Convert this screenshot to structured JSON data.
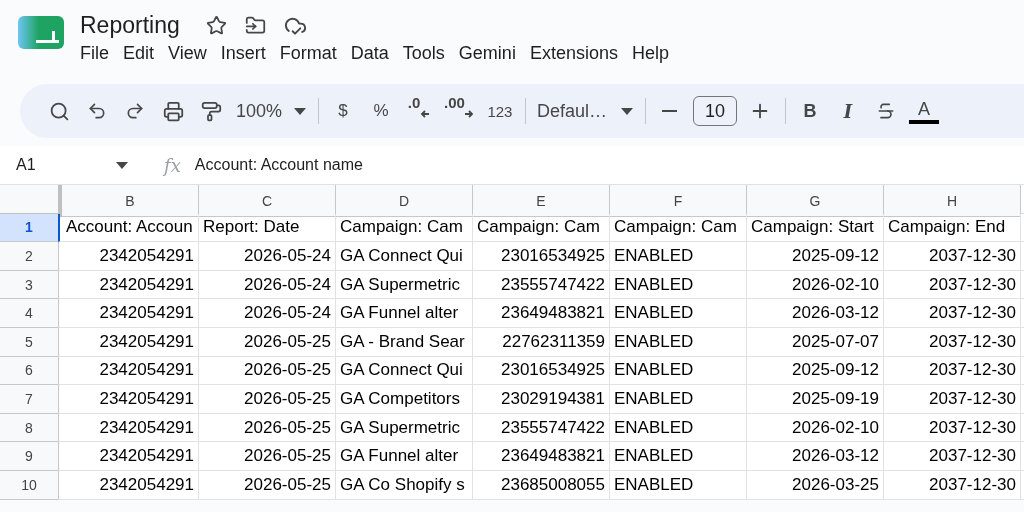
{
  "document": {
    "title": "Reporting"
  },
  "menu": [
    "File",
    "Edit",
    "View",
    "Insert",
    "Format",
    "Data",
    "Tools",
    "Gemini",
    "Extensions",
    "Help"
  ],
  "toolbar": {
    "zoom": "100%",
    "currency": "$",
    "percent": "%",
    "decrease_decimals": ".0",
    "increase_decimals": ".00",
    "number_format": "123",
    "font": "Defaul…",
    "font_size": "10",
    "bold": "B",
    "italic": "I",
    "text_color": "A"
  },
  "formula_bar": {
    "cell_ref": "A1",
    "fx": "fx",
    "formula": "Account: Account name"
  },
  "sheet": {
    "columns": [
      {
        "label": "B",
        "kind": "number"
      },
      {
        "label": "C",
        "kind": "number"
      },
      {
        "label": "D",
        "kind": "text"
      },
      {
        "label": "E",
        "kind": "number"
      },
      {
        "label": "F",
        "kind": "text"
      },
      {
        "label": "G",
        "kind": "number"
      },
      {
        "label": "H",
        "kind": "number"
      }
    ],
    "rows": [
      {
        "number": "1",
        "kind": "header",
        "selected": true,
        "cells": [
          "Account: Accoun",
          "Report: Date",
          "Campaign: Cam",
          "Campaign: Cam",
          "Campaign: Cam",
          "Campaign: Start",
          "Campaign: End"
        ]
      },
      {
        "number": "2",
        "kind": "data",
        "selected": false,
        "cells": [
          "2342054291",
          "2026-05-24",
          "GA Connect Qui",
          "23016534925",
          "ENABLED",
          "2025-09-12",
          "2037-12-30"
        ]
      },
      {
        "number": "3",
        "kind": "data",
        "selected": false,
        "cells": [
          "2342054291",
          "2026-05-24",
          "GA Supermetric",
          "23555747422",
          "ENABLED",
          "2026-02-10",
          "2037-12-30"
        ]
      },
      {
        "number": "4",
        "kind": "data",
        "selected": false,
        "cells": [
          "2342054291",
          "2026-05-24",
          "GA Funnel alter",
          "23649483821",
          "ENABLED",
          "2026-03-12",
          "2037-12-30"
        ]
      },
      {
        "number": "5",
        "kind": "data",
        "selected": false,
        "cells": [
          "2342054291",
          "2026-05-25",
          "GA - Brand Sear",
          "22762311359",
          "ENABLED",
          "2025-07-07",
          "2037-12-30"
        ]
      },
      {
        "number": "6",
        "kind": "data",
        "selected": false,
        "cells": [
          "2342054291",
          "2026-05-25",
          "GA Connect Qui",
          "23016534925",
          "ENABLED",
          "2025-09-12",
          "2037-12-30"
        ]
      },
      {
        "number": "7",
        "kind": "data",
        "selected": false,
        "cells": [
          "2342054291",
          "2026-05-25",
          "GA Competitors",
          "23029194381",
          "ENABLED",
          "2025-09-19",
          "2037-12-30"
        ]
      },
      {
        "number": "8",
        "kind": "data",
        "selected": false,
        "cells": [
          "2342054291",
          "2026-05-25",
          "GA Supermetric",
          "23555747422",
          "ENABLED",
          "2026-02-10",
          "2037-12-30"
        ]
      },
      {
        "number": "9",
        "kind": "data",
        "selected": false,
        "cells": [
          "2342054291",
          "2026-05-25",
          "GA Funnel alter",
          "23649483821",
          "ENABLED",
          "2026-03-12",
          "2037-12-30"
        ]
      },
      {
        "number": "10",
        "kind": "data",
        "selected": false,
        "cells": [
          "2342054291",
          "2026-05-25",
          "GA Co Shopify s",
          "23685008055",
          "ENABLED",
          "2026-03-25",
          "2037-12-30"
        ]
      }
    ]
  }
}
